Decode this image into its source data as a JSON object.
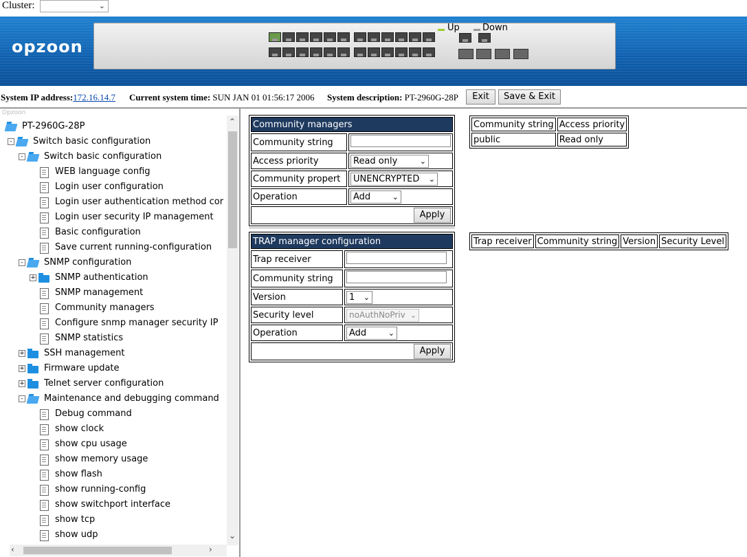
{
  "cluster": {
    "label": "Cluster:",
    "value": ""
  },
  "banner": {
    "logo": "opzoon",
    "legend_up": "Up",
    "legend_down": "Down"
  },
  "info": {
    "ip_label": "System IP address:",
    "ip_value": "172.16.14.7",
    "time_label": "Current system time:",
    "time_value": "SUN JAN 01 01:56:17 2006",
    "desc_label": "System description:",
    "desc_value": "PT-2960G-28P",
    "exit_button": "Exit",
    "save_exit_button": "Save & Exit"
  },
  "sidebar": {
    "title": "Opzoon",
    "items": [
      {
        "label": "PT-2960G-28P"
      },
      {
        "label": "Switch basic configuration"
      },
      {
        "label": "Switch basic configuration"
      },
      {
        "label": "WEB language config"
      },
      {
        "label": "Login user configuration"
      },
      {
        "label": "Login user authentication method cor"
      },
      {
        "label": "Login user security IP management"
      },
      {
        "label": "Basic configuration"
      },
      {
        "label": "Save current running-configuration"
      },
      {
        "label": "SNMP configuration"
      },
      {
        "label": "SNMP authentication"
      },
      {
        "label": "SNMP management"
      },
      {
        "label": "Community managers"
      },
      {
        "label": "Configure snmp manager security IP"
      },
      {
        "label": "SNMP statistics"
      },
      {
        "label": "SSH management"
      },
      {
        "label": "Firmware update"
      },
      {
        "label": "Telnet server configuration"
      },
      {
        "label": "Maintenance and debugging command"
      },
      {
        "label": "Debug command"
      },
      {
        "label": "show clock"
      },
      {
        "label": "show cpu usage"
      },
      {
        "label": "show memory usage"
      },
      {
        "label": "show flash"
      },
      {
        "label": "show running-config"
      },
      {
        "label": "show switchport interface"
      },
      {
        "label": "show tcp"
      },
      {
        "label": "show udp"
      }
    ]
  },
  "community": {
    "title": "Community managers",
    "community_string_label": "Community string",
    "community_string_value": "",
    "access_priority_label": "Access priority",
    "access_priority_value": "Read only",
    "community_property_label": "Community propert",
    "community_property_value": "UNENCRYPTED",
    "operation_label": "Operation",
    "operation_value": "Add",
    "apply": "Apply"
  },
  "community_list": {
    "headers": [
      "Community string",
      "Access priority"
    ],
    "rows": [
      [
        "public",
        "Read only"
      ]
    ]
  },
  "trap": {
    "title": "TRAP manager configuration",
    "receiver_label": "Trap receiver",
    "receiver_value": "",
    "community_string_label": "Community string",
    "community_string_value": "",
    "version_label": "Version",
    "version_value": "1",
    "security_level_label": "Security level",
    "security_level_value": "noAuthNoPriv",
    "operation_label": "Operation",
    "operation_value": "Add",
    "apply": "Apply"
  },
  "trap_list": {
    "headers": [
      "Trap receiver",
      "Community string",
      "Version",
      "Security Level"
    ]
  }
}
